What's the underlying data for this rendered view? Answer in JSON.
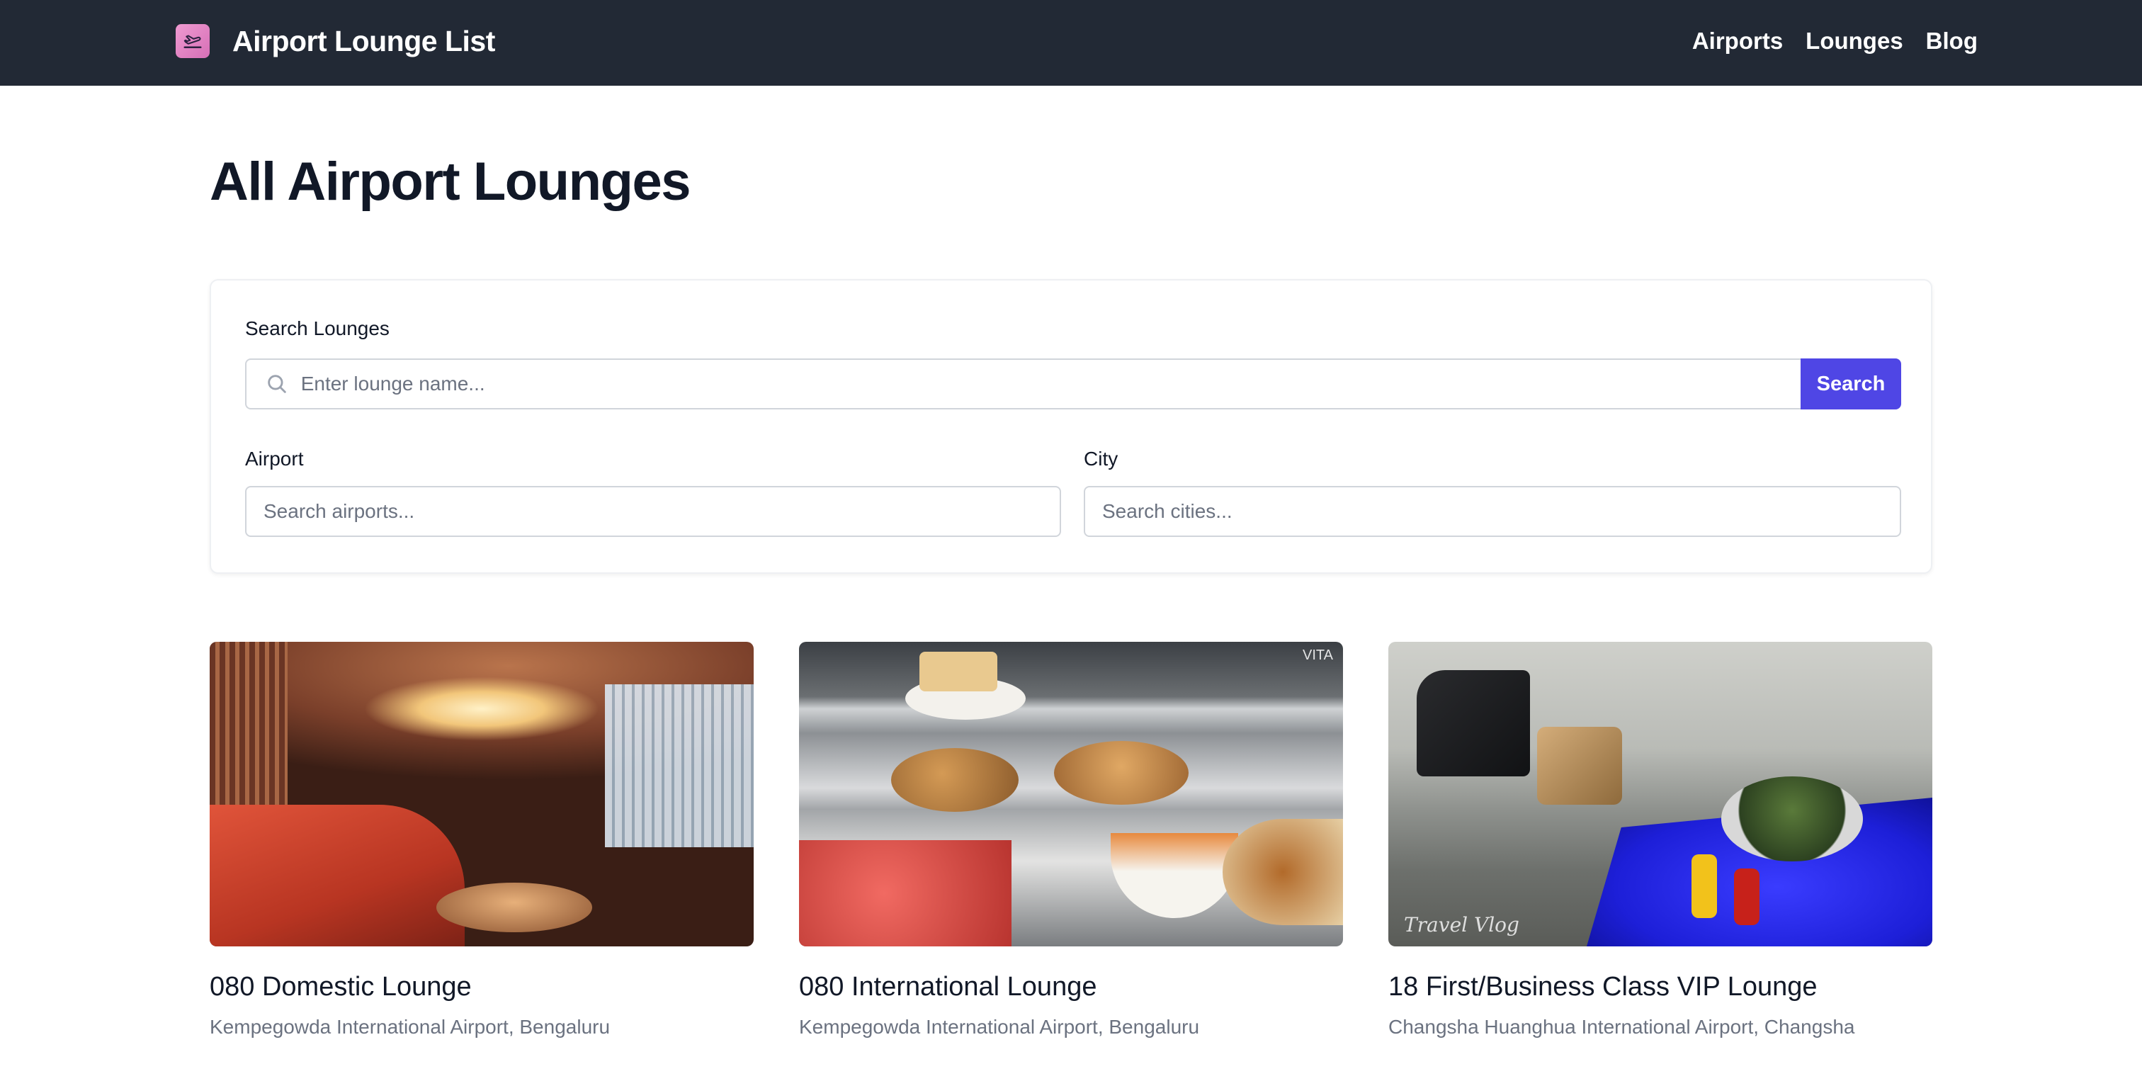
{
  "header": {
    "app_title": "Airport Lounge List",
    "nav": [
      {
        "label": "Airports"
      },
      {
        "label": "Lounges"
      },
      {
        "label": "Blog"
      }
    ],
    "logo_icon": "airplane-departure-icon",
    "colors": {
      "header_bg": "#222935",
      "logo_bg": "#e484c6"
    }
  },
  "main": {
    "title": "All Airport Lounges",
    "search": {
      "label": "Search Lounges",
      "placeholder": "Enter lounge name...",
      "value": "",
      "button_label": "Search",
      "icon": "search-icon",
      "button_color": "#4f46e5"
    },
    "filters": {
      "airport": {
        "label": "Airport",
        "placeholder": "Search airports...",
        "value": ""
      },
      "city": {
        "label": "City",
        "placeholder": "Search cities...",
        "value": ""
      }
    },
    "lounges": [
      {
        "name": "080 Domestic Lounge",
        "location": "Kempegowda International Airport, Bengaluru"
      },
      {
        "name": "080 International Lounge",
        "location": "Kempegowda International Airport, Bengaluru",
        "image_watermark": "VITA"
      },
      {
        "name": "18 First/Business Class VIP Lounge",
        "location": "Changsha Huanghua International Airport, Changsha",
        "image_watermark": "Travel Vlog"
      }
    ]
  }
}
